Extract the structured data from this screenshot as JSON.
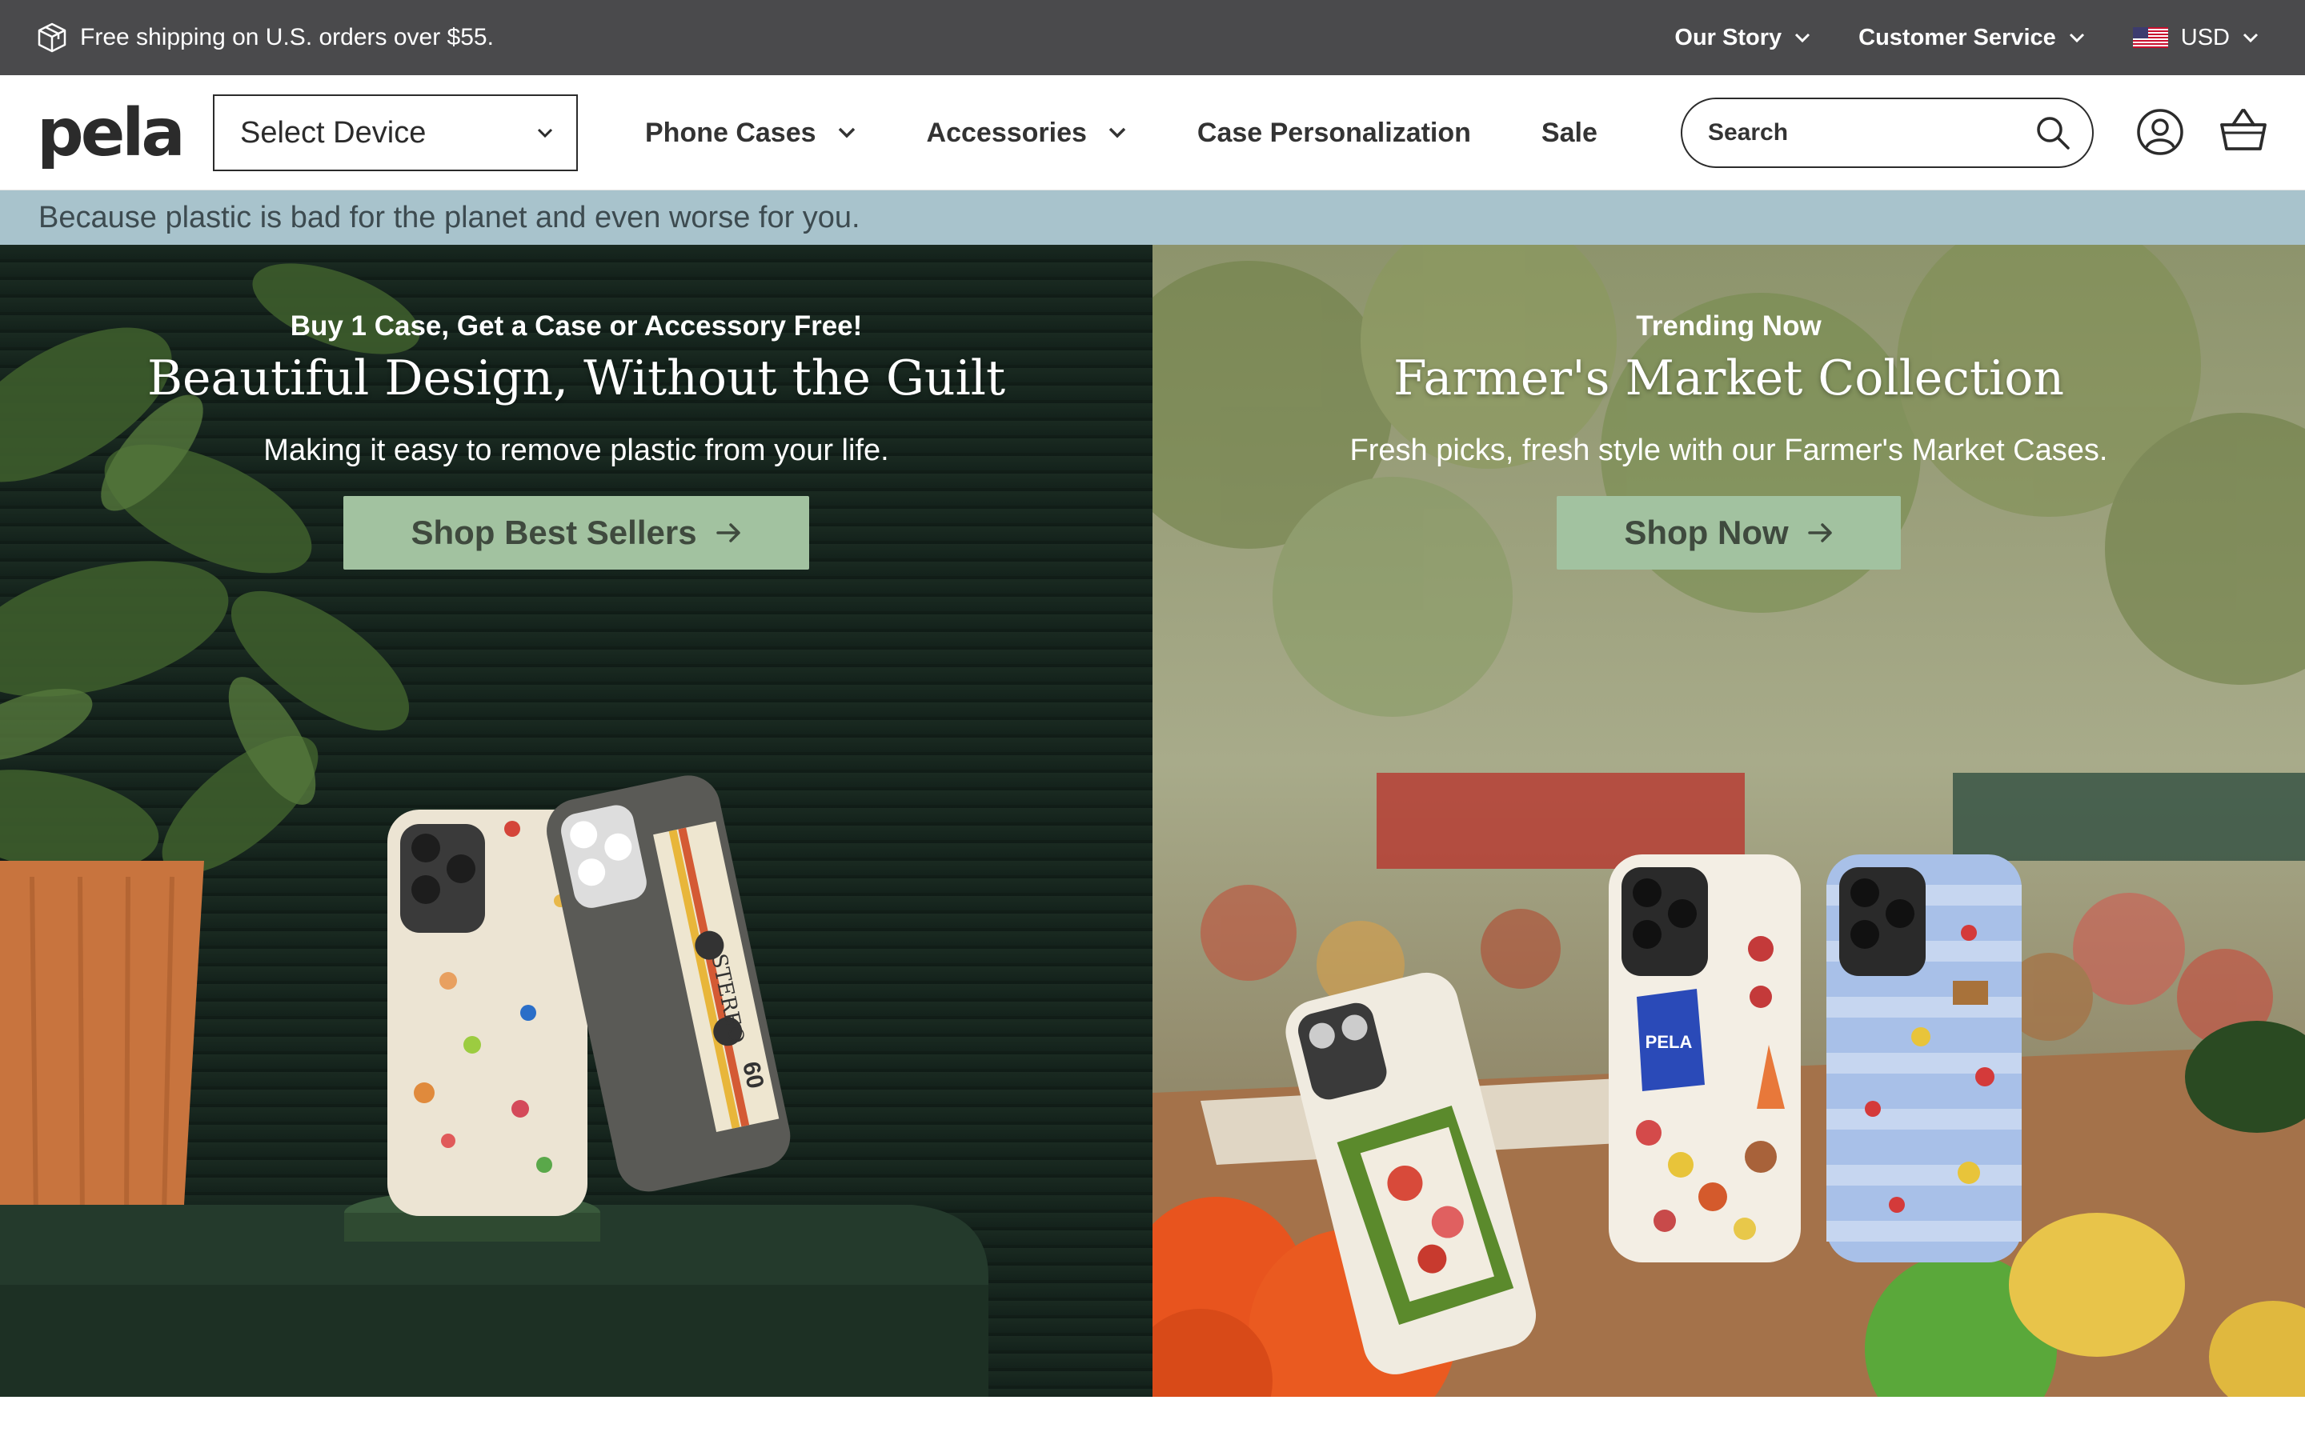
{
  "topbar": {
    "shipping_text": "Free shipping on U.S. orders over $55.",
    "links": [
      "Our Story",
      "Customer Service"
    ],
    "currency": "USD"
  },
  "brand": {
    "logo_text": "pela"
  },
  "nav": {
    "device_select": "Select Device",
    "menu": [
      {
        "label": "Phone Cases",
        "has_dropdown": true
      },
      {
        "label": "Accessories",
        "has_dropdown": true
      },
      {
        "label": "Case Personalization",
        "has_dropdown": false
      },
      {
        "label": "Sale",
        "has_dropdown": false
      }
    ],
    "search_placeholder": "Search"
  },
  "tagline": "Because plastic is bad for the planet and even worse for you.",
  "hero_left": {
    "eyebrow": "Buy 1 Case, Get a Case or Accessory Free!",
    "headline": "Beautiful Design, Without the Guilt",
    "subtext": "Making it easy to remove plastic from your life.",
    "cta": "Shop Best Sellers"
  },
  "hero_right": {
    "eyebrow": "Trending Now",
    "headline": "Farmer's Market Collection",
    "subtext": "Fresh picks, fresh style with our Farmer's Market Cases.",
    "cta": "Shop Now"
  },
  "images": {
    "left_case_label_1": "STEREO",
    "left_case_label_2": "60",
    "right_bag_label": "PELA"
  },
  "colors": {
    "topbar_bg": "#4a4a4c",
    "tagline_bg": "#a8c3cc",
    "cta_bg": "#a2c2a0",
    "cta_text": "#3f4a3e"
  },
  "icons": [
    "box-icon",
    "chevron-down-icon",
    "us-flag-icon",
    "search-icon",
    "account-icon",
    "cart-icon",
    "arrow-right-icon"
  ]
}
